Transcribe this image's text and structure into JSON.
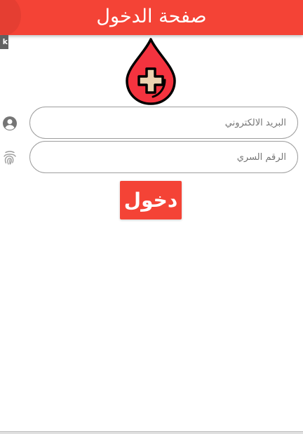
{
  "app_bar": {
    "title": "صفحة الدخول",
    "back_icon": "arrow-back-icon",
    "color": "#f44336"
  },
  "debug_banner": {
    "label": "k"
  },
  "logo": {
    "icon": "blood-drop-medical-cross-icon",
    "drop_color": "#f4333f",
    "cross_color": "#ecd2b0"
  },
  "form": {
    "email": {
      "icon": "account-circle-icon",
      "placeholder": "البريد الالكتروني",
      "value": ""
    },
    "password": {
      "icon": "fingerprint-icon",
      "placeholder": "الرقم السري",
      "value": ""
    },
    "login_label": "دخول"
  }
}
